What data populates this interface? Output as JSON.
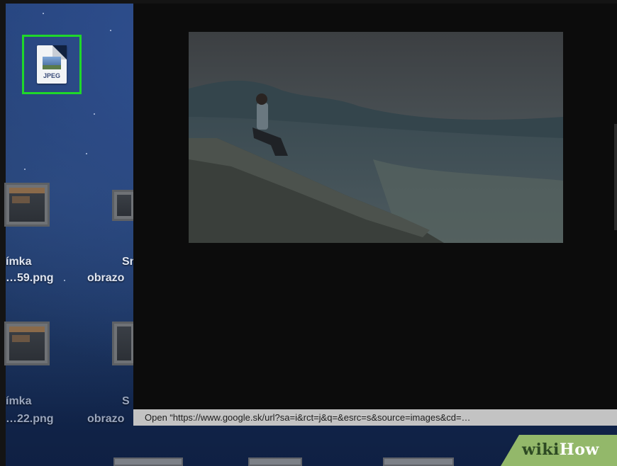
{
  "desktop": {
    "selected_file": {
      "badge_text": "JPEG",
      "icon": "jpeg-file-icon"
    },
    "icons": [
      {
        "line1": "ímka",
        "line2": "…59.png"
      },
      {
        "line1": "Sn",
        "line2": "obrazo"
      },
      {
        "line1": "ímka",
        "line2": "…22.png"
      },
      {
        "line1": "S",
        "line2": "obrazo"
      }
    ]
  },
  "preview": {
    "image_description_icon": "photo-person-on-cliff"
  },
  "status_bar": {
    "text": "Open “https://www.google.sk/url?sa=i&rct=j&q=&esrc=s&source=images&cd=…"
  },
  "watermark": {
    "wiki": "wiki",
    "how": "How"
  },
  "colors": {
    "selection_border": "#1fd82a",
    "window_background": "#0c0c0c",
    "status_bar": "#c3c3c3",
    "watermark_green": "#93b86a"
  }
}
